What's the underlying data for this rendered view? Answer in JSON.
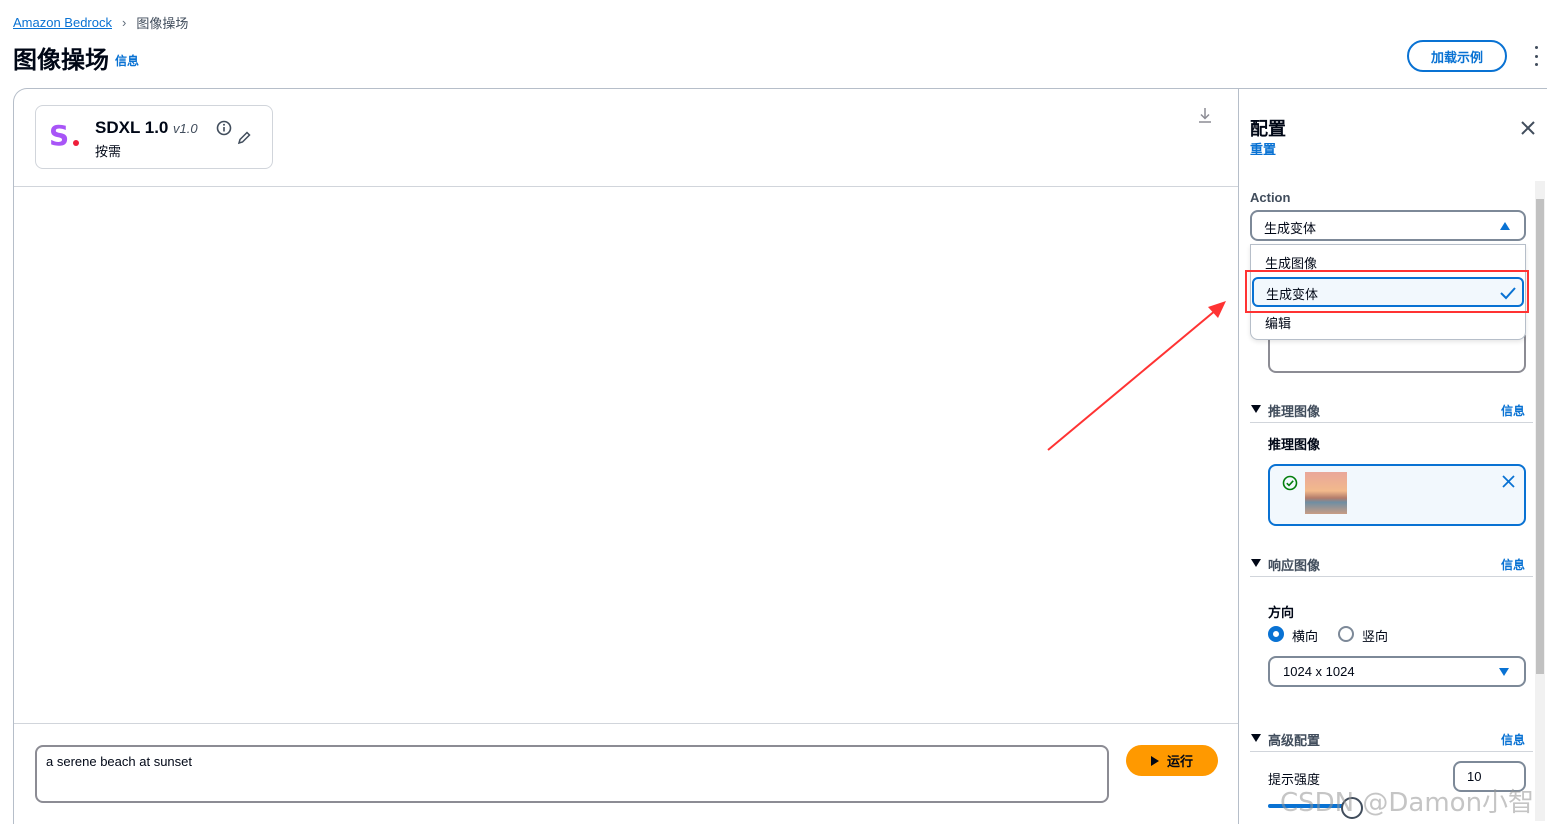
{
  "breadcrumb": {
    "root": "Amazon Bedrock",
    "current": "图像操场"
  },
  "header": {
    "title": "图像操场",
    "info": "信息",
    "load_examples": "加载示例"
  },
  "model": {
    "logo_letter": "S",
    "name": "SDXL 1.0",
    "version": "v1.0",
    "mode": "按需"
  },
  "prompt": {
    "value": "a serene beach at sunset"
  },
  "run": {
    "label": "运行"
  },
  "config": {
    "title": "配置",
    "reset": "重置",
    "action": {
      "label": "Action",
      "selected": "生成变体",
      "options": [
        "生成图像",
        "生成变体",
        "编辑"
      ]
    },
    "inference_image": {
      "section_title": "推理图像",
      "info": "信息",
      "field_label": "推理图像"
    },
    "response_image": {
      "section_title": "响应图像",
      "info": "信息",
      "direction_label": "方向",
      "direction_options": [
        "横向",
        "竖向"
      ],
      "direction_selected": "横向",
      "size": "1024 x 1024"
    },
    "advanced": {
      "section_title": "高级配置",
      "info": "信息",
      "strength_label": "提示强度",
      "strength_value": "10"
    }
  },
  "watermark": "CSDN @Damon小智",
  "colors": {
    "accent": "#0972d3",
    "run_button": "#ff9900",
    "annotation": "#ff3333"
  }
}
